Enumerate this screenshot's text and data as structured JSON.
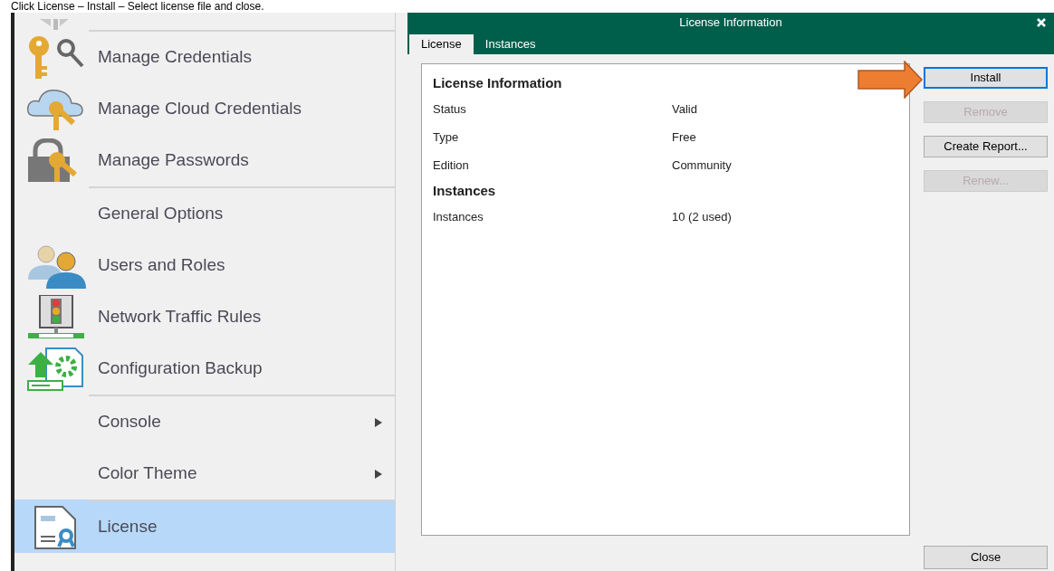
{
  "instruction": "Click License – Install – Select license file and close.",
  "menu": {
    "items": [
      {
        "label": "Manage Credentials",
        "submenu": false,
        "selected": false,
        "separator_before": true
      },
      {
        "label": "Manage Cloud Credentials",
        "submenu": false,
        "selected": false,
        "separator_before": false
      },
      {
        "label": "Manage Passwords",
        "submenu": false,
        "selected": false,
        "separator_before": false
      },
      {
        "label": "General Options",
        "submenu": false,
        "selected": false,
        "separator_before": true
      },
      {
        "label": "Users and Roles",
        "submenu": false,
        "selected": false,
        "separator_before": false
      },
      {
        "label": "Network Traffic Rules",
        "submenu": false,
        "selected": false,
        "separator_before": false
      },
      {
        "label": "Configuration Backup",
        "submenu": false,
        "selected": false,
        "separator_before": false
      },
      {
        "label": "Console",
        "submenu": true,
        "selected": false,
        "separator_before": true
      },
      {
        "label": "Color Theme",
        "submenu": true,
        "selected": false,
        "separator_before": false
      },
      {
        "label": "License",
        "submenu": false,
        "selected": true,
        "separator_before": true
      }
    ]
  },
  "dialog": {
    "title": "License Information",
    "tabs": [
      {
        "label": "License",
        "selected": true
      },
      {
        "label": "Instances",
        "selected": false
      }
    ],
    "sections": [
      {
        "heading": "License Information",
        "rows": [
          {
            "label": "Status",
            "value": "Valid"
          },
          {
            "label": "Type",
            "value": "Free"
          },
          {
            "label": "Edition",
            "value": "Community"
          }
        ]
      },
      {
        "heading": "Instances",
        "rows": [
          {
            "label": "Instances",
            "value": "10 (2 used)"
          }
        ]
      }
    ],
    "buttons": [
      {
        "label": "Install",
        "disabled": false,
        "focused": true
      },
      {
        "label": "Remove",
        "disabled": true,
        "focused": false
      },
      {
        "label": "Create Report...",
        "disabled": false,
        "focused": false
      },
      {
        "label": "Renew...",
        "disabled": true,
        "focused": false
      }
    ],
    "close_button": {
      "label": "Close"
    }
  }
}
